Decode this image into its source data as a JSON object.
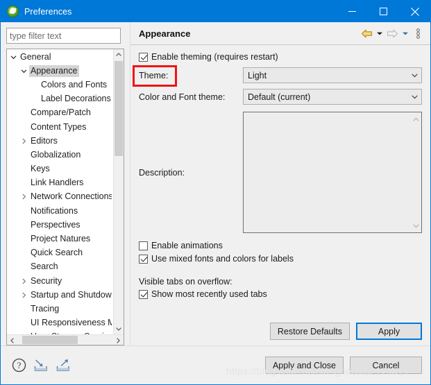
{
  "window": {
    "title": "Preferences",
    "app_icon": "eclipse-leaf-icon",
    "minimize_label": "Minimize",
    "maximize_label": "Maximize",
    "close_label": "Close",
    "accent_color": "#0078d7"
  },
  "sidebar": {
    "filter": {
      "value": "",
      "placeholder": "type filter text"
    },
    "items": [
      {
        "label": "General",
        "indent": 0,
        "twisty": "expanded",
        "selected": false
      },
      {
        "label": "Appearance",
        "indent": 1,
        "twisty": "expanded",
        "selected": true
      },
      {
        "label": "Colors and Fonts",
        "indent": 2,
        "twisty": "none",
        "selected": false
      },
      {
        "label": "Label Decorations",
        "indent": 2,
        "twisty": "none",
        "selected": false
      },
      {
        "label": "Compare/Patch",
        "indent": 1,
        "twisty": "none",
        "selected": false
      },
      {
        "label": "Content Types",
        "indent": 1,
        "twisty": "none",
        "selected": false
      },
      {
        "label": "Editors",
        "indent": 1,
        "twisty": "collapsed",
        "selected": false
      },
      {
        "label": "Globalization",
        "indent": 1,
        "twisty": "none",
        "selected": false
      },
      {
        "label": "Keys",
        "indent": 1,
        "twisty": "none",
        "selected": false
      },
      {
        "label": "Link Handlers",
        "indent": 1,
        "twisty": "none",
        "selected": false
      },
      {
        "label": "Network Connections",
        "indent": 1,
        "twisty": "collapsed",
        "selected": false
      },
      {
        "label": "Notifications",
        "indent": 1,
        "twisty": "none",
        "selected": false
      },
      {
        "label": "Perspectives",
        "indent": 1,
        "twisty": "none",
        "selected": false
      },
      {
        "label": "Project Natures",
        "indent": 1,
        "twisty": "none",
        "selected": false
      },
      {
        "label": "Quick Search",
        "indent": 1,
        "twisty": "none",
        "selected": false
      },
      {
        "label": "Search",
        "indent": 1,
        "twisty": "none",
        "selected": false
      },
      {
        "label": "Security",
        "indent": 1,
        "twisty": "collapsed",
        "selected": false
      },
      {
        "label": "Startup and Shutdown",
        "indent": 1,
        "twisty": "collapsed",
        "selected": false
      },
      {
        "label": "Tracing",
        "indent": 1,
        "twisty": "none",
        "selected": false
      },
      {
        "label": "UI Responsiveness Monitoring",
        "indent": 1,
        "twisty": "none",
        "selected": false
      },
      {
        "label": "User Storage Service",
        "indent": 1,
        "twisty": "collapsed",
        "selected": false
      }
    ]
  },
  "page": {
    "title": "Appearance",
    "toolbar": {
      "back_icon": "back-arrow-icon",
      "back_menu_icon": "chevron-down-icon",
      "forward_icon": "forward-arrow-icon",
      "forward_menu_icon": "chevron-down-icon",
      "menu_icon": "vertical-dots-icon"
    },
    "enable_theming": {
      "label": "Enable theming (requires restart)",
      "checked": true
    },
    "theme": {
      "label": "Theme:",
      "value": "Light",
      "highlighted": true,
      "highlight_color": "#f01414"
    },
    "color_font_theme": {
      "label": "Color and Font theme:",
      "value": "Default (current)"
    },
    "description": {
      "label": "Description:",
      "value": ""
    },
    "enable_animations": {
      "label": "Enable animations",
      "checked": false
    },
    "mixed_fonts": {
      "label": "Use mixed fonts and colors for labels",
      "checked": true
    },
    "visible_tabs_label": "Visible tabs on overflow:",
    "show_mru_tabs": {
      "label": "Show most recently used tabs",
      "checked": true
    },
    "restore_defaults_label": "Restore Defaults",
    "apply_label": "Apply"
  },
  "footer": {
    "help_icon": "help-question-icon",
    "import_icon": "import-icon",
    "export_icon": "export-icon",
    "apply_and_close_label": "Apply and Close",
    "cancel_label": "Cancel",
    "watermark": "https://blog.csdn.net/lianghecai52174314"
  }
}
